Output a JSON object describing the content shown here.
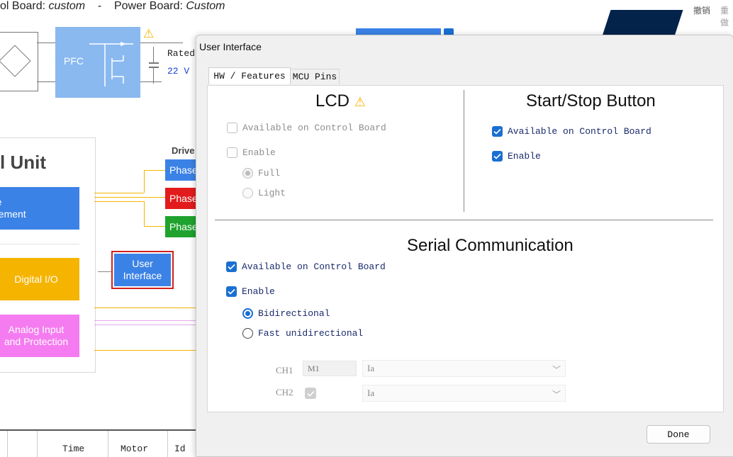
{
  "background_app": {
    "header": {
      "control_board_label": "ol Board:",
      "control_board_value": "custom",
      "separator": "-",
      "power_board_label": "Power Board:",
      "power_board_value": "Custom"
    },
    "pfc_label": "PFC",
    "rated_label": "Rated",
    "rated_value": "22 V",
    "unit_title": "l Unit",
    "driver_label": "Drive",
    "phase_labels": [
      "Phase",
      "Phase",
      "Phase"
    ],
    "phase_colors": [
      "#3b82e6",
      "#e21c1c",
      "#1fa32e"
    ],
    "management_label": "re\ngement",
    "digital_io_label": "Digital I/O",
    "user_interface_label": "User\nInterface",
    "analog_label": "Analog Input\nand Protection",
    "top_right_labels": [
      "撤销",
      "重做"
    ],
    "table_headers": [
      "Time",
      "Motor",
      "Id"
    ]
  },
  "dialog": {
    "title": "User Interface",
    "tabs": [
      {
        "label": "HW / Features",
        "active": true
      },
      {
        "label": "MCU Pins",
        "active": false
      }
    ],
    "lcd": {
      "title": "LCD",
      "warning_icon": "warning-icon",
      "available_label": "Available on Control Board",
      "available_checked": false,
      "enable_label": "Enable",
      "enable_checked": false,
      "full_label": "Full",
      "light_label": "Light",
      "selected_mode": "Full"
    },
    "start_stop": {
      "title": "Start/Stop Button",
      "available_label": "Available on Control Board",
      "available_checked": true,
      "enable_label": "Enable",
      "enable_checked": true
    },
    "serial": {
      "title": "Serial Communication",
      "available_label": "Available on Control Board",
      "available_checked": true,
      "enable_label": "Enable",
      "enable_checked": true,
      "bidirectional_label": "Bidirectional",
      "fast_unidirectional_label": "Fast unidirectional",
      "selected_mode": "Bidirectional",
      "channels": [
        {
          "label": "CH1",
          "motor": "M1",
          "value": "Ia"
        },
        {
          "label": "CH2",
          "motor": "",
          "value": "Ia"
        }
      ]
    },
    "done_label": "Done"
  },
  "colors": {
    "accent": "#1a6fd1",
    "warning": "#f5b400",
    "enabled_text": "#1a2a6c",
    "disabled_text": "#8e8e8e"
  }
}
